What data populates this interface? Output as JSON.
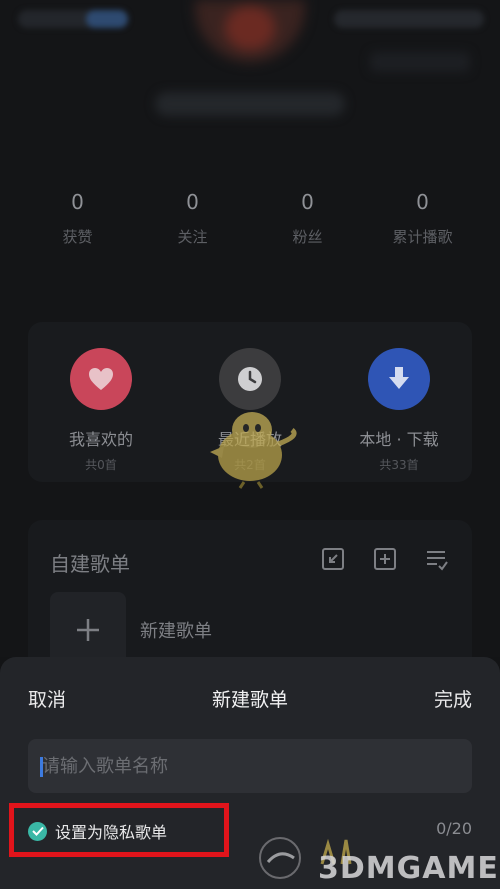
{
  "stats": [
    {
      "value": "0",
      "label": "获赞"
    },
    {
      "value": "0",
      "label": "关注"
    },
    {
      "value": "0",
      "label": "粉丝"
    },
    {
      "value": "0",
      "label": "累计播歌"
    }
  ],
  "quick_access": [
    {
      "label": "我喜欢的",
      "sub": "共0首",
      "icon": "heart-icon",
      "color": "#e0455f"
    },
    {
      "label": "最近播放",
      "sub": "共2首",
      "icon": "clock-icon",
      "color": "#4a4a4a"
    },
    {
      "label": "本地 · 下载",
      "sub": "共33首",
      "icon": "download-icon",
      "color": "#3b6ee0"
    }
  ],
  "playlists": {
    "title": "自建歌单",
    "new_label": "新建歌单"
  },
  "sheet": {
    "cancel": "取消",
    "title": "新建歌单",
    "done": "完成",
    "input_placeholder": "请输入歌单名称",
    "privacy_label": "设置为隐私歌单",
    "counter": "0/20"
  },
  "watermark": {
    "text": "3DMGAME"
  },
  "colors": {
    "accent_check": "#3ab8a6",
    "highlight": "#e1141b",
    "cursor": "#3d7be0"
  }
}
